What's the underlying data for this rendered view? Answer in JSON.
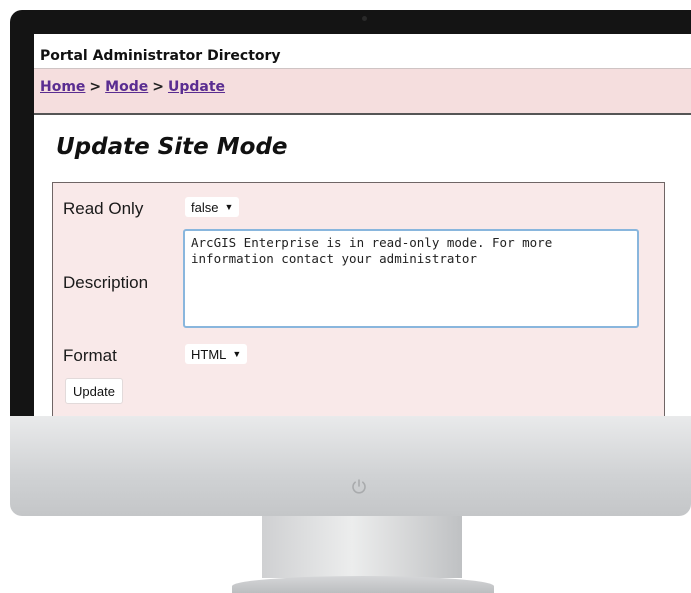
{
  "header": {
    "title": "Portal Administrator Directory"
  },
  "breadcrumb": {
    "items": [
      {
        "label": "Home"
      },
      {
        "label": "Mode"
      },
      {
        "label": "Update"
      }
    ],
    "separator": ">"
  },
  "page": {
    "title": "Update Site Mode"
  },
  "form": {
    "read_only": {
      "label": "Read Only",
      "selected": "false"
    },
    "description": {
      "label": "Description",
      "value": "ArcGIS Enterprise is in read-only mode. For more information contact your administrator"
    },
    "format": {
      "label": "Format",
      "selected": "HTML"
    },
    "submit_label": "Update"
  },
  "colors": {
    "breadcrumb_bg": "#f5dede",
    "panel_bg": "#f9e9e9",
    "link": "#5a2d91",
    "textarea_border": "#89b6dd"
  }
}
